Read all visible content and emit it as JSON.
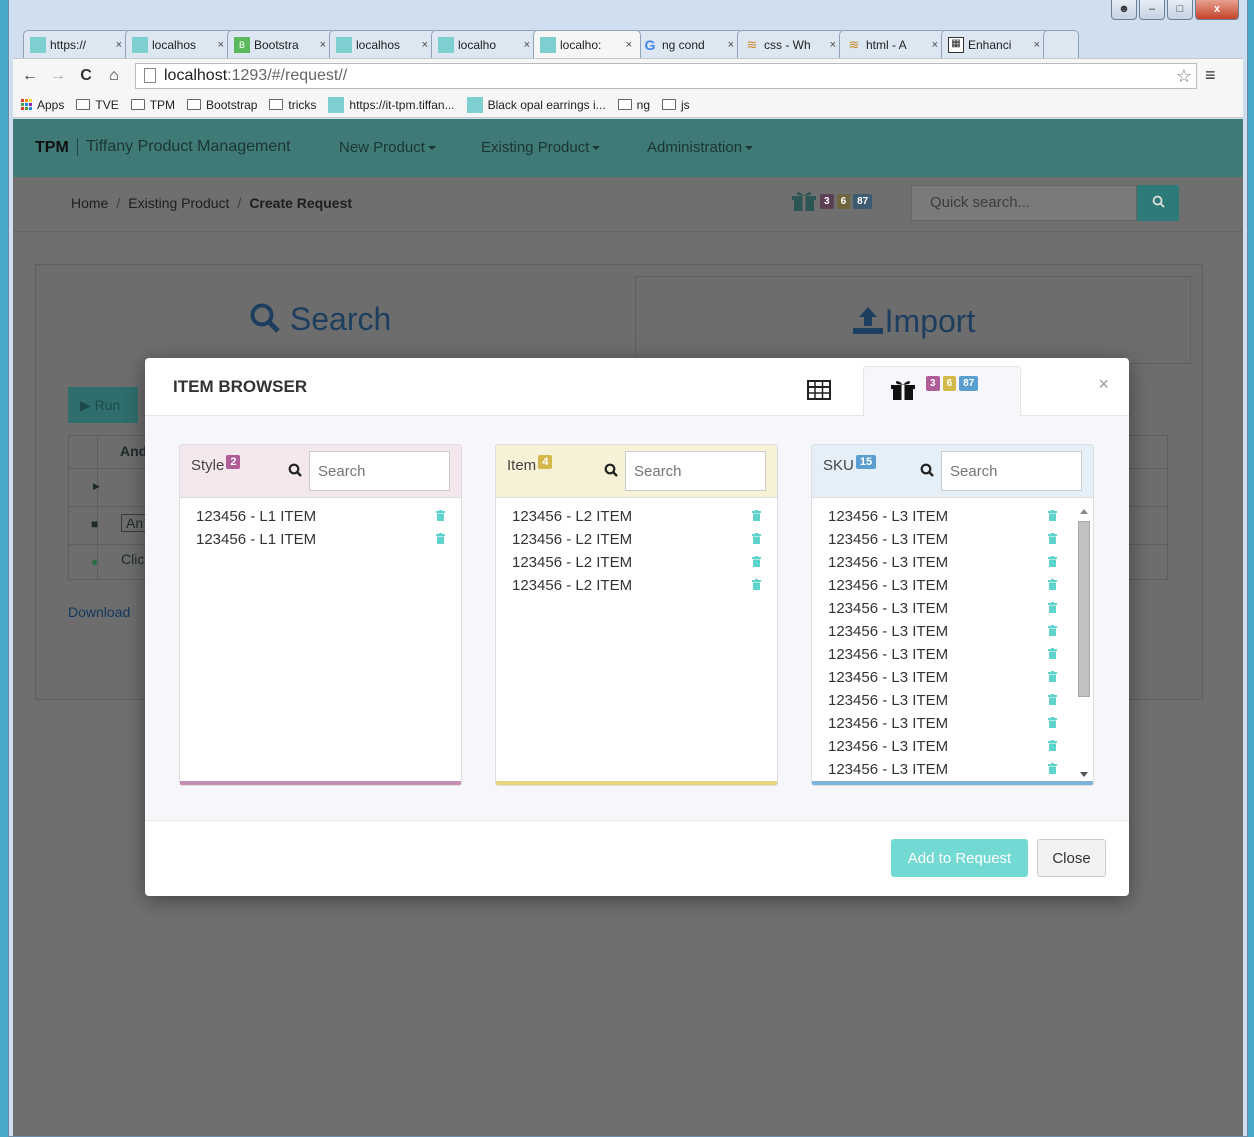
{
  "browser": {
    "tabs": [
      {
        "label": "https://",
        "icon": "teal"
      },
      {
        "label": "localhos",
        "icon": "teal"
      },
      {
        "label": "Bootstra",
        "icon": "bootstrap"
      },
      {
        "label": "localhos",
        "icon": "teal"
      },
      {
        "label": "localho",
        "icon": "teal"
      },
      {
        "label": "localho:",
        "icon": "teal",
        "active": true
      },
      {
        "label": "ng cond",
        "icon": "google"
      },
      {
        "label": "css - Wh",
        "icon": "stack"
      },
      {
        "label": "html - A",
        "icon": "stack"
      },
      {
        "label": "Enhanci",
        "icon": "table"
      }
    ],
    "tab_close": "×",
    "url_host": "localhost",
    "url_path": ":1293/#/request//",
    "bookmarks": [
      "Apps",
      "TVE",
      "TPM",
      "Bootstrap",
      "tricks",
      "https://it-tpm.tiffan...",
      "Black opal earrings i...",
      "ng",
      "js"
    ]
  },
  "app": {
    "brand": "TPM",
    "brand_sub": "Tiffany Product Management",
    "nav": [
      "New Product",
      "Existing Product",
      "Administration"
    ],
    "breadcrumb": [
      "Home",
      "Existing Product",
      "Create Request"
    ],
    "quick_search_placeholder": "Quick search...",
    "badge_counts": [
      "3",
      "6",
      "87"
    ],
    "search_title": "Search",
    "import_title": "Import",
    "run_label": "Run",
    "partial_labels": {
      "and": "And",
      "an": "An",
      "clic": "Clic",
      "download": "Download"
    }
  },
  "modal": {
    "title": "ITEM BROWSER",
    "basket_badges": [
      "3",
      "6",
      "87"
    ],
    "close_x": "×",
    "columns": [
      {
        "title": "Style",
        "count": "2",
        "placeholder": "Search",
        "items": [
          "123456 - L1 ITEM",
          "123456 - L1 ITEM"
        ]
      },
      {
        "title": "Item",
        "count": "4",
        "placeholder": "Search",
        "items": [
          "123456 - L2 ITEM",
          "123456 - L2 ITEM",
          "123456 - L2 ITEM",
          "123456 - L2 ITEM"
        ]
      },
      {
        "title": "SKU",
        "count": "15",
        "placeholder": "Search",
        "items": [
          "123456 - L3 ITEM",
          "123456 - L3 ITEM",
          "123456 - L3 ITEM",
          "123456 - L3 ITEM",
          "123456 - L3 ITEM",
          "123456 - L3 ITEM",
          "123456 - L3 ITEM",
          "123456 - L3 ITEM",
          "123456 - L3 ITEM",
          "123456 - L3 ITEM",
          "123456 - L3 ITEM",
          "123456 - L3 ITEM"
        ]
      }
    ],
    "add_button": "Add to Request",
    "close_button": "Close"
  },
  "colors": {
    "badge_purple": "#b05d97",
    "badge_yellow": "#d4b84a",
    "badge_blue": "#5a9fd0",
    "navbar": "#3f7a77",
    "teal_accent": "#72d9d3",
    "trash_icon": "#5fd3cc"
  }
}
